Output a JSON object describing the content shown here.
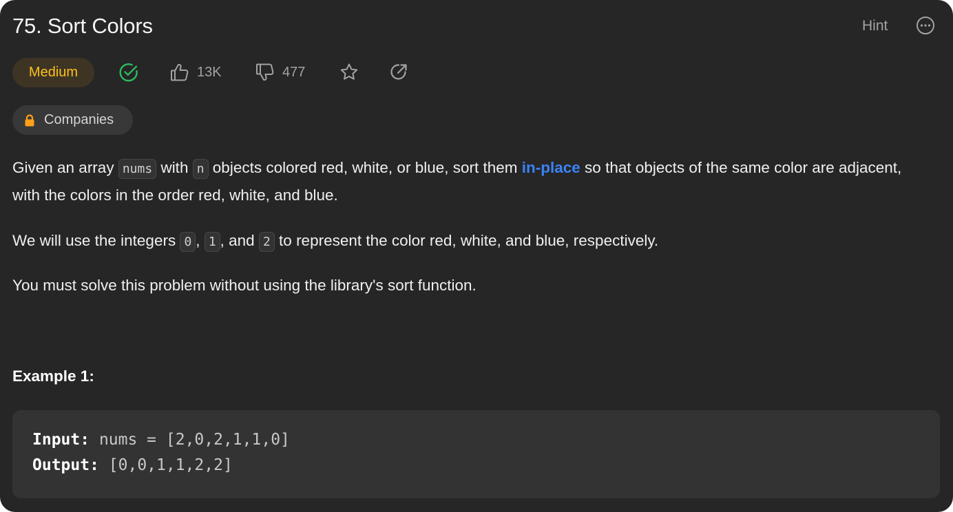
{
  "header": {
    "title": "75. Sort Colors",
    "hint_label": "Hint",
    "more_icon": "ellipsis-circle-icon"
  },
  "meta": {
    "difficulty": "Medium",
    "difficulty_color": "#ffc01e",
    "solved_icon": "check-circle-icon",
    "solved_color": "#2cbb5d",
    "likes": "13K",
    "dislikes": "477",
    "favorite_icon": "star-icon",
    "share_icon": "share-icon"
  },
  "companies": {
    "label": "Companies",
    "icon": "lock-icon",
    "icon_color": "#ffa116"
  },
  "description": {
    "p1": {
      "t1": "Given an array ",
      "c1": "nums",
      "t2": " with ",
      "c2": "n",
      "t3": " objects colored red, white, or blue, sort them ",
      "link": "in-place",
      "t4": " so that objects of the same color are adjacent, with the colors in the order red, white, and blue."
    },
    "p2": {
      "t1": "We will use the integers ",
      "c1": "0",
      "t2": ", ",
      "c2": "1",
      "t3": ", and ",
      "c3": "2",
      "t4": " to represent the color red, white, and blue, respectively."
    },
    "p3": "You must solve this problem without using the library's sort function."
  },
  "example": {
    "title": "Example 1:",
    "input_label": "Input:",
    "input_value": " nums = [2,0,2,1,1,0]",
    "output_label": "Output:",
    "output_value": " [0,0,1,1,2,2]"
  },
  "colors": {
    "panel_bg": "#262626",
    "link": "#3b82f6"
  }
}
